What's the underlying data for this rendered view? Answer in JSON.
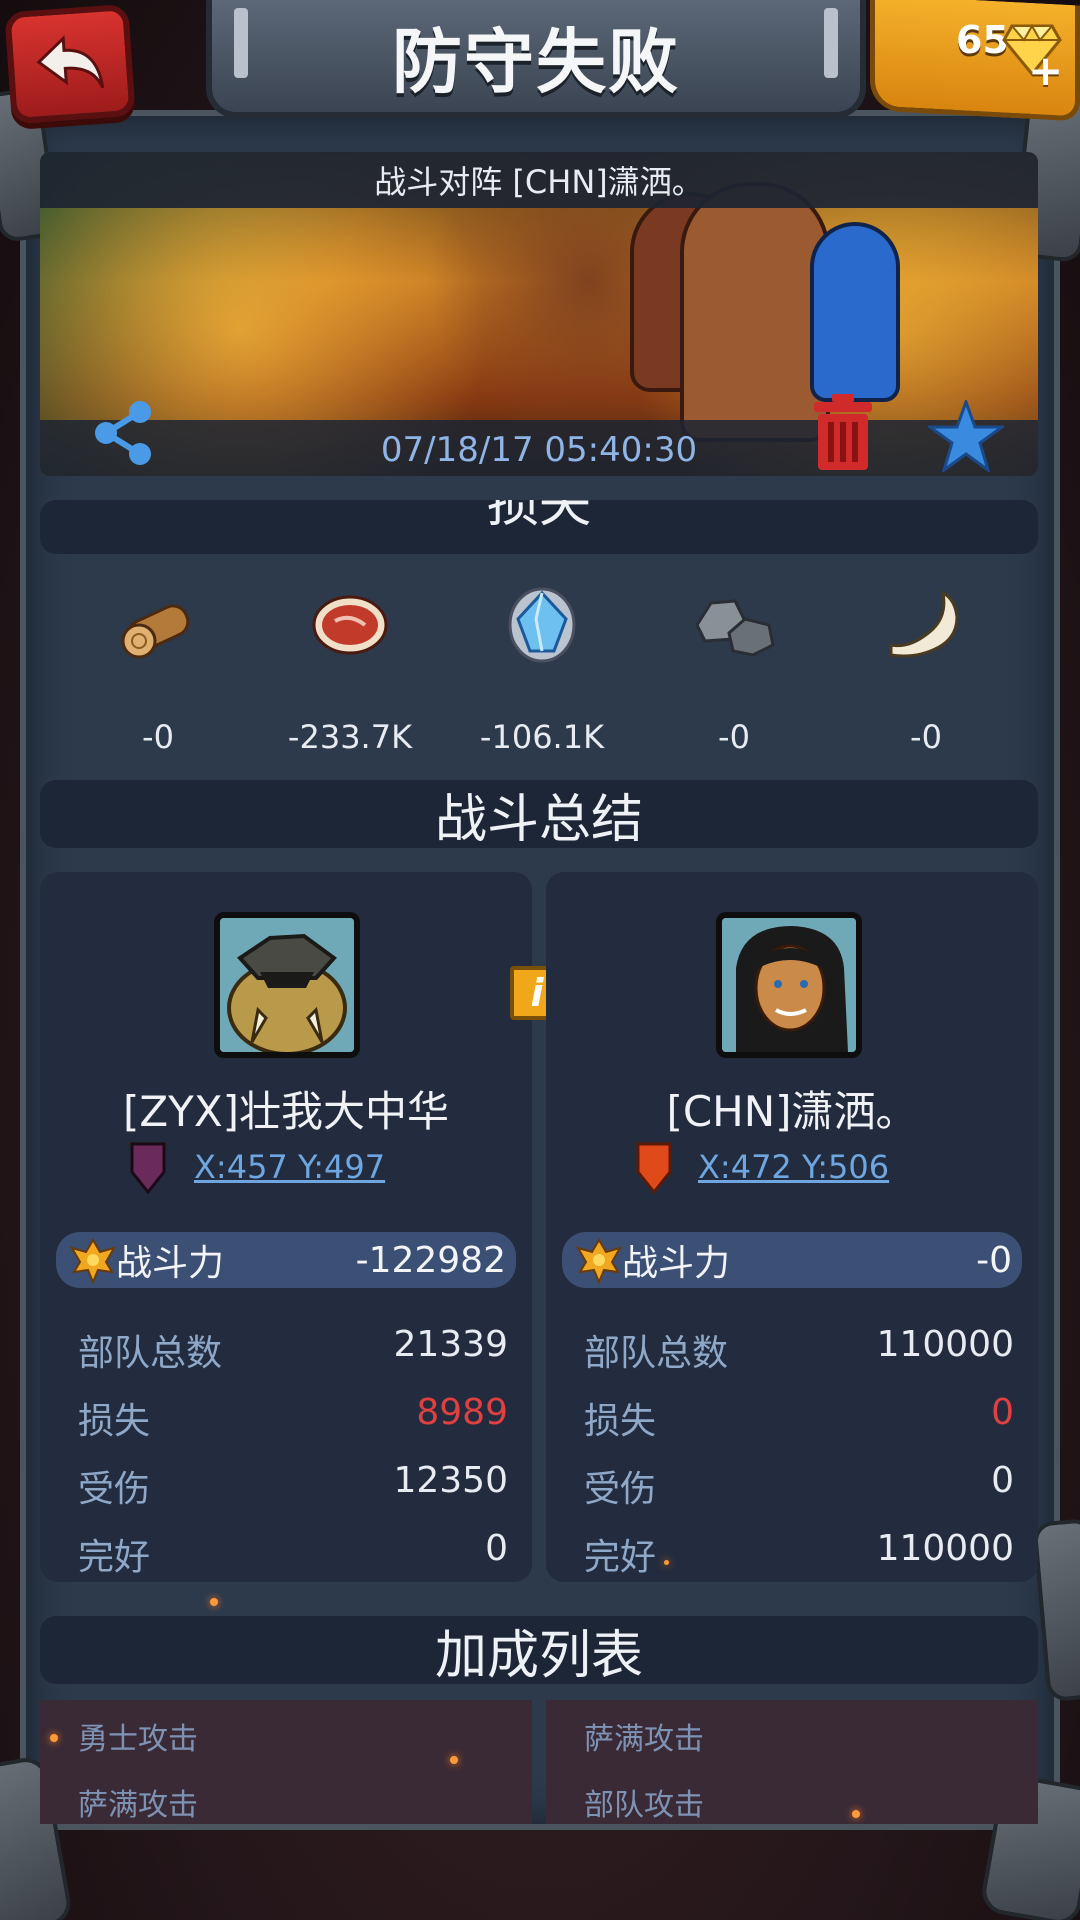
{
  "header": {
    "title": "防守失败",
    "gems": "65",
    "gem_plus": "+"
  },
  "banner": {
    "title": "战斗对阵 [CHN]潇洒。",
    "timestamp": "07/18/17 05:40:30"
  },
  "loss": {
    "section_title": "损失",
    "resources": [
      {
        "icon": "wood-log-icon",
        "value": "-0"
      },
      {
        "icon": "meat-icon",
        "value": "-233.7K"
      },
      {
        "icon": "crystal-icon",
        "value": "-106.1K"
      },
      {
        "icon": "stone-icon",
        "value": "-0"
      },
      {
        "icon": "bone-icon",
        "value": "-0"
      }
    ]
  },
  "summary": {
    "section_title": "战斗总结",
    "info_label": "i",
    "left": {
      "name": "[ZYX]壮我大中华",
      "coords": "X:457 Y:497",
      "power_label": "战斗力",
      "power_value": "-122982",
      "rows": [
        {
          "label": "部队总数",
          "value": "21339"
        },
        {
          "label": "损失",
          "value": "8989"
        },
        {
          "label": "受伤",
          "value": "12350"
        },
        {
          "label": "完好",
          "value": "0"
        }
      ]
    },
    "right": {
      "name": "[CHN]潇洒。",
      "coords": "X:472 Y:506",
      "power_label": "战斗力",
      "power_value": "-0",
      "rows": [
        {
          "label": "部队总数",
          "value": "110000"
        },
        {
          "label": "损失",
          "value": "0"
        },
        {
          "label": "受伤",
          "value": "0"
        },
        {
          "label": "完好",
          "value": "110000"
        }
      ]
    }
  },
  "bonus": {
    "section_title": "加成列表",
    "left": [
      "勇士攻击",
      "萨满攻击"
    ],
    "right": [
      "萨满攻击",
      "部队攻击"
    ]
  },
  "colors": {
    "loss_red": "#e04040",
    "link_blue": "#6fa6e0",
    "panel": "#222c3e"
  }
}
